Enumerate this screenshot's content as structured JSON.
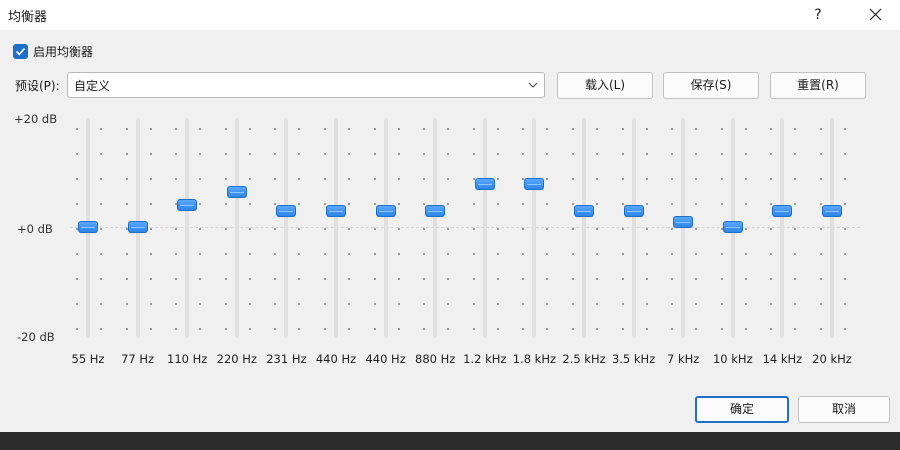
{
  "window": {
    "title": "均衡器",
    "help_label": "?"
  },
  "enable": {
    "label": "启用均衡器",
    "checked": true
  },
  "preset": {
    "label": "预设(P):",
    "value": "自定义"
  },
  "buttons": {
    "load": "载入(L)",
    "save": "保存(S)",
    "reset": "重置(R)",
    "ok": "确定",
    "cancel": "取消"
  },
  "scale": {
    "max": "+20 dB",
    "zero": "+0 dB",
    "min": "-20 dB"
  },
  "bands": [
    {
      "label": "55 Hz",
      "gain_db": 0
    },
    {
      "label": "77 Hz",
      "gain_db": 0
    },
    {
      "label": "110 Hz",
      "gain_db": 4
    },
    {
      "label": "220 Hz",
      "gain_db": 6.5
    },
    {
      "label": "231 Hz",
      "gain_db": 3
    },
    {
      "label": "440 Hz",
      "gain_db": 3
    },
    {
      "label": "440 Hz",
      "gain_db": 3
    },
    {
      "label": "880 Hz",
      "gain_db": 3
    },
    {
      "label": "1.2 kHz",
      "gain_db": 8
    },
    {
      "label": "1.8 kHz",
      "gain_db": 8
    },
    {
      "label": "2.5 kHz",
      "gain_db": 3
    },
    {
      "label": "3.5 kHz",
      "gain_db": 3
    },
    {
      "label": "7 kHz",
      "gain_db": 1
    },
    {
      "label": "10 kHz",
      "gain_db": 0
    },
    {
      "label": "14 kHz",
      "gain_db": 3
    },
    {
      "label": "20 kHz",
      "gain_db": 3
    }
  ],
  "colors": {
    "accent": "#2f86e6",
    "checkbox": "#1f6fc9"
  }
}
